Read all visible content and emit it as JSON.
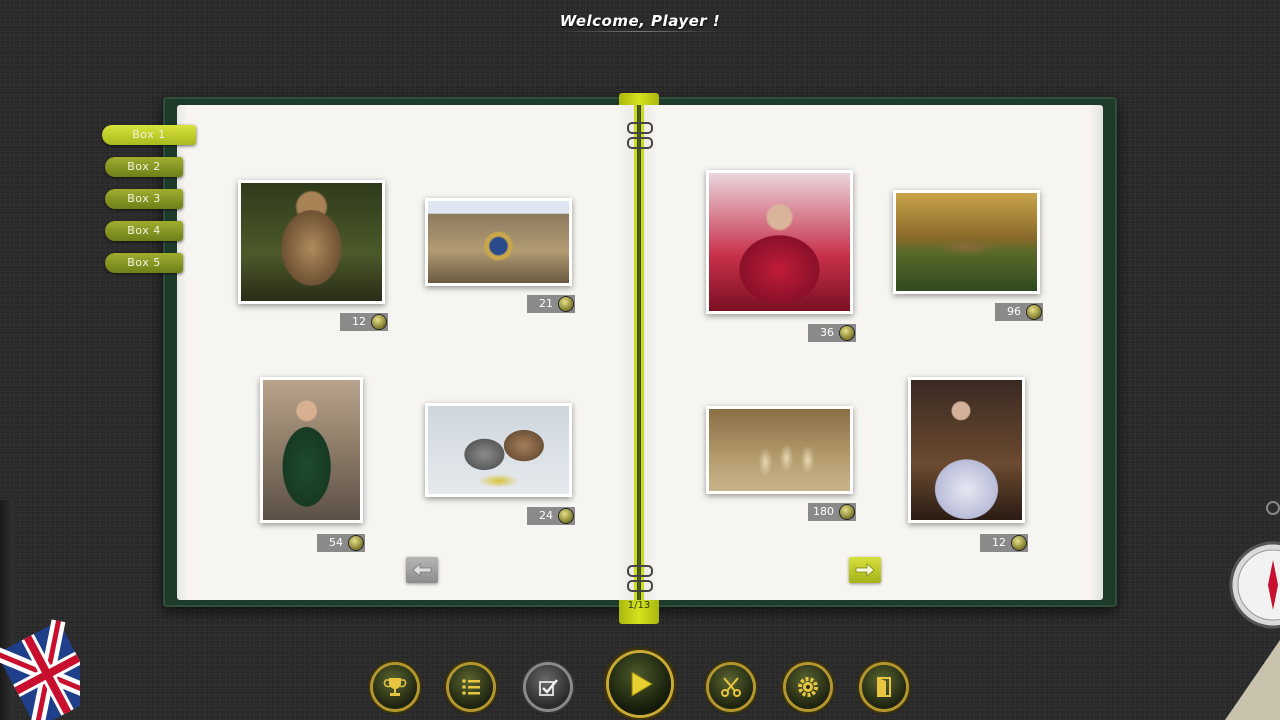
{
  "header": {
    "welcome": "Welcome, Player !"
  },
  "boxes": [
    {
      "label": "Box 1",
      "active": true
    },
    {
      "label": "Box 2",
      "active": false
    },
    {
      "label": "Box 3",
      "active": false
    },
    {
      "label": "Box 4",
      "active": false
    },
    {
      "label": "Box 5",
      "active": false
    }
  ],
  "pagination": {
    "indicator": "1/13"
  },
  "puzzles": [
    {
      "name": "statue",
      "price": "12"
    },
    {
      "name": "astronomical-clock",
      "price": "21"
    },
    {
      "name": "bagpiper",
      "price": "54"
    },
    {
      "name": "armor-gauntlets",
      "price": "24"
    },
    {
      "name": "veiled-woman",
      "price": "36"
    },
    {
      "name": "castle-landscape",
      "price": "96"
    },
    {
      "name": "amphorae",
      "price": "180"
    },
    {
      "name": "woman-in-gown",
      "price": "12"
    }
  ],
  "toolbar": {
    "buttons": [
      "trophy-icon",
      "list-icon",
      "checkbox-icon",
      "play-icon",
      "scissors-icon",
      "gear-icon",
      "exit-door-icon"
    ]
  },
  "colors": {
    "accent": "#c9d42a",
    "cover": "#1e3a2b",
    "price_badge": "#8a8a8a",
    "gold": "#b3962e"
  }
}
